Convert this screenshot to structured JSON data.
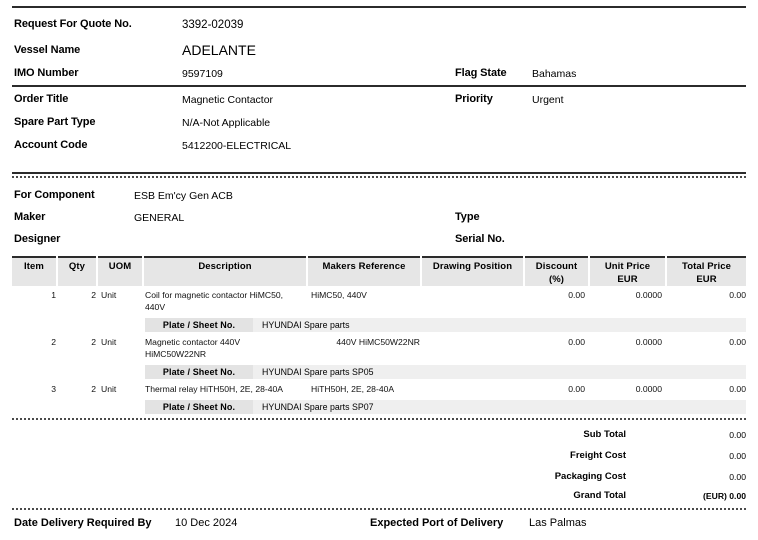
{
  "header": {
    "fields": [
      {
        "label": "Request For Quote No.",
        "value": "3392-02039"
      },
      {
        "label": "Vessel Name",
        "value": "ADELANTE"
      },
      {
        "label": "IMO Number",
        "value": "9597109"
      },
      {
        "label": "Order Title",
        "value": "Magnetic Contactor"
      },
      {
        "label": "Spare Part Type",
        "value": "N/A-Not Applicable"
      },
      {
        "label": "Account Code",
        "value": "5412200-ELECTRICAL"
      }
    ],
    "flag_state_label": "Flag State",
    "flag_state_value": "Bahamas",
    "priority_label": "Priority",
    "priority_value": "Urgent"
  },
  "component": {
    "for_component_label": "For Component",
    "for_component_value": "ESB Em'cy Gen ACB",
    "maker_label": "Maker",
    "maker_value": "GENERAL",
    "designer_label": "Designer",
    "designer_value": "",
    "type_label": "Type",
    "type_value": "",
    "serial_no_label": "Serial No.",
    "serial_no_value": ""
  },
  "table": {
    "columns": [
      {
        "line1": "Item",
        "line2": ""
      },
      {
        "line1": "Qty",
        "line2": ""
      },
      {
        "line1": "UOM",
        "line2": ""
      },
      {
        "line1": "Description",
        "line2": ""
      },
      {
        "line1": "Makers Reference",
        "line2": ""
      },
      {
        "line1": "Drawing Position",
        "line2": ""
      },
      {
        "line1": "Discount",
        "line2": "(%)"
      },
      {
        "line1": "Unit Price",
        "line2": "EUR"
      },
      {
        "line1": "Total Price",
        "line2": "EUR"
      }
    ],
    "plate_label": "Plate / Sheet No.",
    "rows": [
      {
        "item": "1",
        "qty": "2",
        "uom": "Unit",
        "description": "Coil for magnetic contactor HiMC50, 440V",
        "makers_reference": "HiMC50, 440V",
        "drawing_position": "",
        "discount": "0.00",
        "unit_price": "0.0000",
        "total_price": "0.00",
        "plate_value": "HYUNDAI Spare parts"
      },
      {
        "item": "2",
        "qty": "2",
        "uom": "Unit",
        "description": "Magnetic contactor 440V HiMC50W22NR",
        "makers_reference": "440V HiMC50W22NR",
        "drawing_position": "",
        "discount": "0.00",
        "unit_price": "0.0000",
        "total_price": "0.00",
        "plate_value": "HYUNDAI Spare parts SP05"
      },
      {
        "item": "3",
        "qty": "2",
        "uom": "Unit",
        "description": "Thermal relay HiTH50H, 2E, 28-40A",
        "makers_reference": "HiTH50H, 2E, 28-40A",
        "drawing_position": "",
        "discount": "0.00",
        "unit_price": "0.0000",
        "total_price": "0.00",
        "plate_value": "HYUNDAI Spare parts SP07"
      }
    ]
  },
  "totals": [
    {
      "label": "Sub Total",
      "value": "0.00"
    },
    {
      "label": "Freight Cost",
      "value": "0.00"
    },
    {
      "label": "Packaging Cost",
      "value": "0.00"
    },
    {
      "label": "Grand Total",
      "value": "(EUR) 0.00"
    }
  ],
  "footer": {
    "date_label": "Date Delivery Required By",
    "date_value": "10 Dec 2024",
    "port_label": "Expected Port of Delivery",
    "port_value": "Las Palmas"
  }
}
